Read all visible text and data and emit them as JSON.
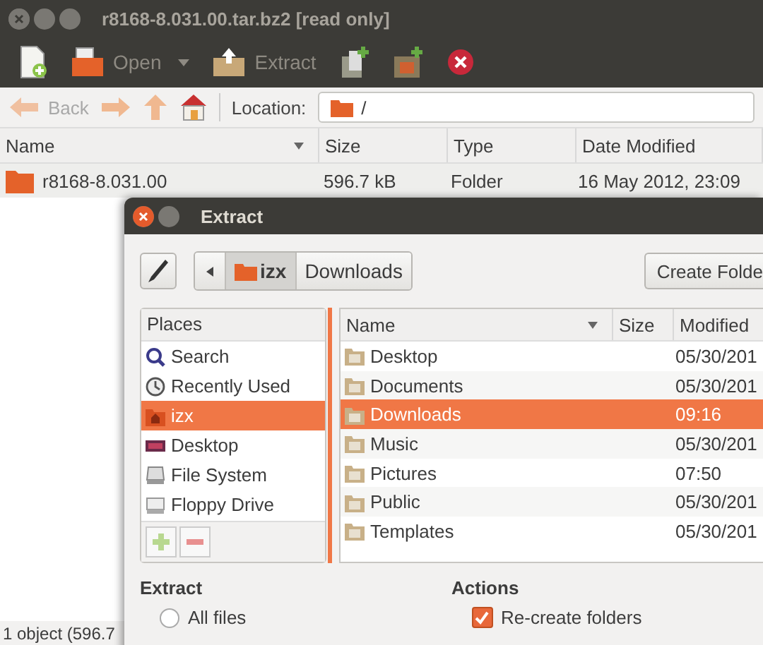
{
  "main_window": {
    "title": "r8168-8.031.00.tar.bz2 [read only]",
    "toolbar": [
      {
        "kind": "new"
      },
      {
        "kind": "open",
        "label": "Open"
      },
      {
        "kind": "extract",
        "label": "Extract"
      },
      {
        "kind": "add-files"
      },
      {
        "kind": "add-folder"
      },
      {
        "kind": "stop"
      }
    ],
    "nav": {
      "back": "Back",
      "location_label": "Location:",
      "location": "/"
    },
    "columns": [
      "Name",
      "Size",
      "Type",
      "Date Modified"
    ],
    "rows": [
      {
        "name": "r8168-8.031.00",
        "size": "596.7 kB",
        "type": "Folder",
        "modified": "16 May 2012, 23:09"
      }
    ],
    "status_bar": "1 object (596.7"
  },
  "dialog": {
    "title": "Extract",
    "path": [
      {
        "label": "izx",
        "selected": true
      },
      {
        "label": "Downloads",
        "selected": false
      }
    ],
    "create_folder": "Create Folde",
    "places_header": "Places",
    "places": [
      {
        "kind": "search",
        "label": "Search",
        "selected": false
      },
      {
        "kind": "recent",
        "label": "Recently Used",
        "selected": false
      },
      {
        "kind": "home",
        "label": "izx",
        "selected": true
      },
      {
        "kind": "desktop",
        "label": "Desktop",
        "selected": false
      },
      {
        "kind": "drive",
        "label": "File System",
        "selected": false
      },
      {
        "kind": "floppy",
        "label": "Floppy Drive",
        "selected": false
      }
    ],
    "file_columns": [
      "Name",
      "Size",
      "Modified"
    ],
    "files": [
      {
        "name": "Desktop",
        "modified": "05/30/201",
        "selected": false
      },
      {
        "name": "Documents",
        "modified": "05/30/201",
        "selected": false
      },
      {
        "name": "Downloads",
        "modified": "09:16",
        "selected": true
      },
      {
        "name": "Music",
        "modified": "05/30/201",
        "selected": false
      },
      {
        "name": "Pictures",
        "modified": "07:50",
        "selected": false
      },
      {
        "name": "Public",
        "modified": "05/30/201",
        "selected": false
      },
      {
        "name": "Templates",
        "modified": "05/30/201",
        "selected": false
      }
    ],
    "extract": {
      "title": "Extract",
      "option": "All files",
      "selected": false
    },
    "actions": {
      "title": "Actions",
      "option": "Re-create folders",
      "checked": true
    }
  }
}
